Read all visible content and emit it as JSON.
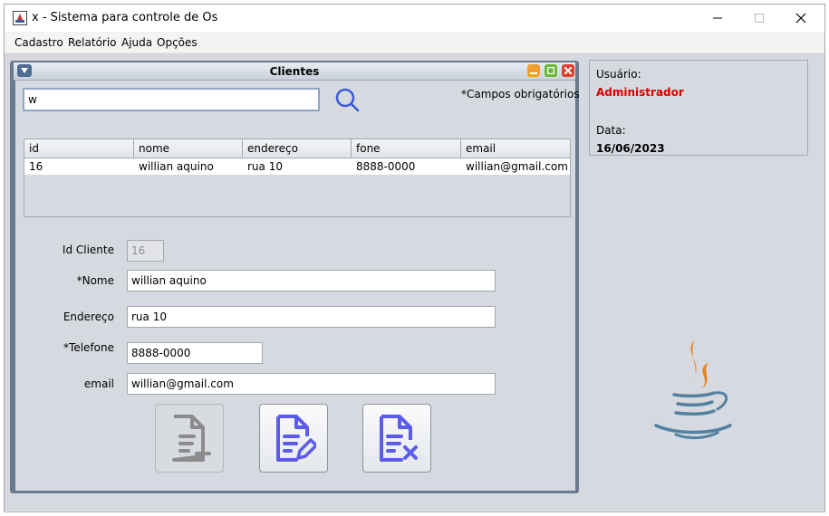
{
  "window": {
    "title": "x - Sistema para controle de Os"
  },
  "menubar": {
    "items": [
      "Cadastro",
      "Relatório",
      "Ajuda",
      "Opções"
    ]
  },
  "internal_frame": {
    "title": "Clientes"
  },
  "search": {
    "value": "w"
  },
  "required_note": "*Campos obrigatórios",
  "table": {
    "columns": [
      "id",
      "nome",
      "endereço",
      "fone",
      "email"
    ],
    "rows": [
      [
        "16",
        "willian aquino",
        "rua 10",
        "8888-0000",
        "willian@gmail.com"
      ]
    ]
  },
  "form": {
    "id_label": "Id Cliente",
    "id_value": "16",
    "nome_label": "*Nome",
    "nome_value": "willian aquino",
    "endereco_label": "Endereço",
    "endereco_value": "rua 10",
    "telefone_label": "*Telefone",
    "telefone_value": "8888-0000",
    "email_label": "email",
    "email_value": "willian@gmail.com"
  },
  "side_panel": {
    "user_label": "Usuário:",
    "user_value": "Administrador",
    "date_label": "Data:",
    "date_value": "16/06/2023"
  },
  "icons": {
    "add": "file-add-icon",
    "edit": "file-edit-icon",
    "delete": "file-delete-icon",
    "search": "search-icon",
    "logo": "java-logo"
  },
  "colors": {
    "accent_icon": "#5b5ce8",
    "user_red": "#e00000",
    "search_icon": "#3a59d8",
    "frame_minimize": "#f0a030",
    "frame_maximize": "#6cb83a",
    "frame_close": "#e04030",
    "java_orange": "#e8821e",
    "java_blue": "#5382a1"
  }
}
